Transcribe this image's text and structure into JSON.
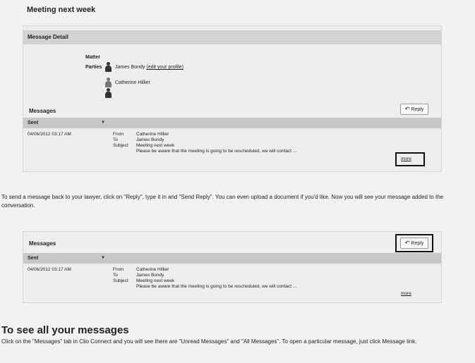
{
  "page_title": "Meeting next week",
  "message_detail": {
    "heading": "Message Detail",
    "matter_label": "Matter",
    "parties_label": "Parties",
    "party1_name": "James Bondy",
    "party1_link": "(edit your profile)",
    "party2_name": "Catherine Hillier",
    "messages_heading": "Messages",
    "reply_label": "Reply",
    "sent_header": "Sent",
    "row": {
      "date": "04/06/2012 03:17 AM",
      "from_label": "From",
      "from_value": "Catherine Hillier",
      "to_label": "To",
      "to_value": "James Bondy",
      "subject_label": "Subject",
      "subject_value": "Meeting next week",
      "preview": "Please be aware that the meeting is going to be rescheduled, we will contact ...",
      "more": "more"
    }
  },
  "instruction_text": "To send a message back to your lawyer, click on \"Reply\", type it in and \"Send Reply\".  You can even upload a document if you'd like.  Now you will see your message added to the conversation.",
  "messages_panel": {
    "heading": "Messages",
    "reply_label": "Reply",
    "sent_header": "Sent",
    "row": {
      "date": "04/06/2012 03:17 AM",
      "from_label": "From",
      "from_value": "Catherine Hillier",
      "to_label": "To",
      "to_value": "James Bondy",
      "subject_label": "Subject",
      "subject_value": "Meeting next week",
      "preview": "Please be aware that the meeting is going to be rescheduled, we will contact ...",
      "more": "more"
    }
  },
  "section2_heading": "To see all your messages",
  "section2_text": "Click on the \"Messages\" tab in Clio Connect and you will see there are \"Unread Messages\" and \"All Messages\".  To open a particular message, just click Message link."
}
